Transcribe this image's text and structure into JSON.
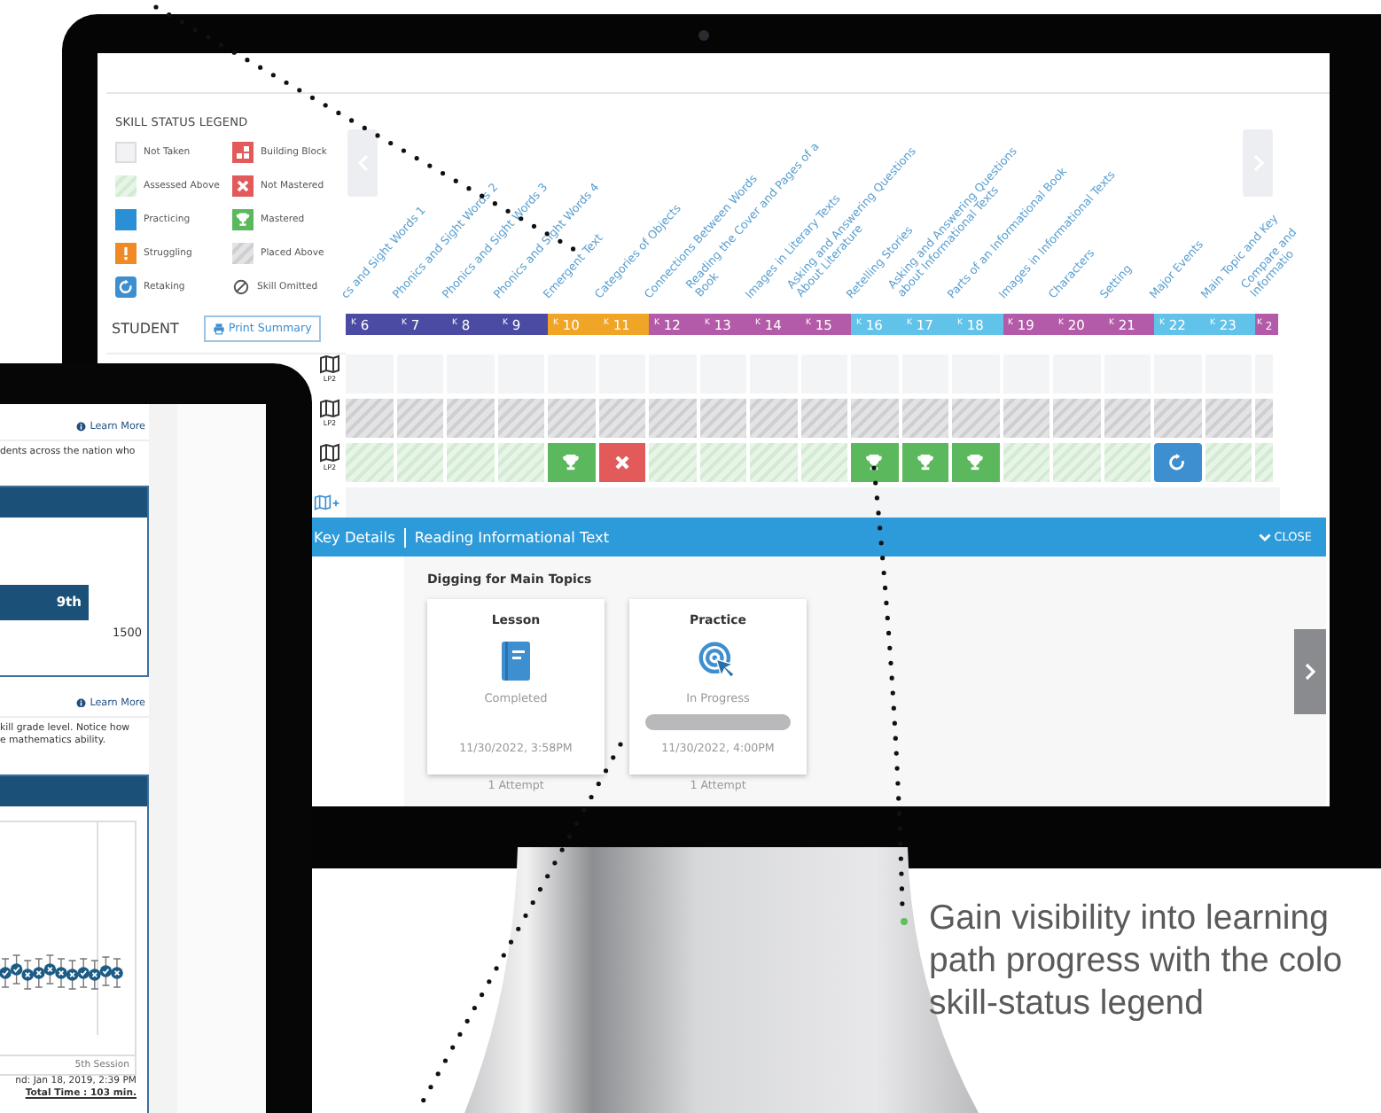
{
  "monitor": {
    "legend": {
      "title": "SKILL STATUS LEGEND",
      "items": [
        {
          "label": "Not Taken",
          "kind": "not-taken"
        },
        {
          "label": "Building Block",
          "kind": "building-block"
        },
        {
          "label": "Assessed Above",
          "kind": "assessed-above"
        },
        {
          "label": "Not Mastered",
          "kind": "not-mastered"
        },
        {
          "label": "Practicing",
          "kind": "practicing"
        },
        {
          "label": "Mastered",
          "kind": "mastered"
        },
        {
          "label": "Struggling",
          "kind": "struggling"
        },
        {
          "label": "Placed Above",
          "kind": "placed-above"
        },
        {
          "label": "Retaking",
          "kind": "retaking"
        },
        {
          "label": "Skill Omitted",
          "kind": "skill-omitted"
        }
      ]
    },
    "student_header": "STUDENT",
    "print_button": "Print Summary",
    "columns": [
      {
        "grade": "K",
        "number": "6",
        "skill": [
          "cs and Sight Words 1"
        ],
        "color": "#4b4ba3"
      },
      {
        "grade": "K",
        "number": "7",
        "skill": [
          "Phonics and Sight Words 2"
        ],
        "color": "#4b4ba3"
      },
      {
        "grade": "K",
        "number": "8",
        "skill": [
          "Phonics and Sight Words 3"
        ],
        "color": "#4b4ba3"
      },
      {
        "grade": "K",
        "number": "9",
        "skill": [
          "Phonics and Sight Words 4"
        ],
        "color": "#4b4ba3"
      },
      {
        "grade": "K",
        "number": "10",
        "skill": [
          "Emergent Text"
        ],
        "color": "#f0a526"
      },
      {
        "grade": "K",
        "number": "11",
        "skill": [
          "Categories of Objects"
        ],
        "color": "#f0a526"
      },
      {
        "grade": "K",
        "number": "12",
        "skill": [
          "Connections Between Words"
        ],
        "color": "#b35ba8"
      },
      {
        "grade": "K",
        "number": "13",
        "skill": [
          "Reading the Cover and Pages of a",
          "Book"
        ],
        "color": "#b35ba8"
      },
      {
        "grade": "K",
        "number": "14",
        "skill": [
          "Images in Literary Texts"
        ],
        "color": "#b35ba8"
      },
      {
        "grade": "K",
        "number": "15",
        "skill": [
          "Asking and Answering Questions",
          "About Literature"
        ],
        "color": "#b35ba8"
      },
      {
        "grade": "K",
        "number": "16",
        "skill": [
          "Retelling Stories"
        ],
        "color": "#62c3ea"
      },
      {
        "grade": "K",
        "number": "17",
        "skill": [
          "Asking and Answering Questions",
          "about Informational Texts"
        ],
        "color": "#62c3ea"
      },
      {
        "grade": "K",
        "number": "18",
        "skill": [
          "Parts of an Informational Book"
        ],
        "color": "#62c3ea"
      },
      {
        "grade": "K",
        "number": "19",
        "skill": [
          "Images in Informational Texts"
        ],
        "color": "#b35ba8"
      },
      {
        "grade": "K",
        "number": "20",
        "skill": [
          "Characters"
        ],
        "color": "#b35ba8"
      },
      {
        "grade": "K",
        "number": "21",
        "skill": [
          "Setting"
        ],
        "color": "#b35ba8"
      },
      {
        "grade": "K",
        "number": "22",
        "skill": [
          "Major Events"
        ],
        "color": "#62c3ea"
      },
      {
        "grade": "K",
        "number": "23",
        "skill": [
          "Main Topic and Key"
        ],
        "color": "#62c3ea"
      },
      {
        "grade": "K",
        "number": "2",
        "skill": [
          "Compare and",
          "Informatio"
        ],
        "color": "#b35ba8"
      }
    ],
    "rows": [
      {
        "path": "LP2",
        "cells": [
          {
            "kind": "not-taken"
          },
          {
            "kind": "not-taken"
          },
          {
            "kind": "not-taken"
          },
          {
            "kind": "not-taken"
          },
          {
            "kind": "not-taken"
          },
          {
            "kind": "not-taken"
          },
          {
            "kind": "not-taken"
          },
          {
            "kind": "not-taken"
          },
          {
            "kind": "not-taken"
          },
          {
            "kind": "not-taken"
          },
          {
            "kind": "not-taken"
          },
          {
            "kind": "not-taken"
          },
          {
            "kind": "not-taken"
          },
          {
            "kind": "not-taken"
          },
          {
            "kind": "not-taken"
          },
          {
            "kind": "not-taken"
          },
          {
            "kind": "not-taken"
          },
          {
            "kind": "not-taken"
          },
          {
            "kind": "not-taken"
          }
        ]
      },
      {
        "path": "LP2",
        "cells": [
          {
            "kind": "placed-above"
          },
          {
            "kind": "placed-above"
          },
          {
            "kind": "placed-above"
          },
          {
            "kind": "placed-above"
          },
          {
            "kind": "placed-above"
          },
          {
            "kind": "placed-above"
          },
          {
            "kind": "placed-above"
          },
          {
            "kind": "placed-above"
          },
          {
            "kind": "placed-above"
          },
          {
            "kind": "placed-above"
          },
          {
            "kind": "placed-above"
          },
          {
            "kind": "placed-above"
          },
          {
            "kind": "placed-above"
          },
          {
            "kind": "placed-above"
          },
          {
            "kind": "placed-above"
          },
          {
            "kind": "placed-above"
          },
          {
            "kind": "placed-above"
          },
          {
            "kind": "placed-above"
          },
          {
            "kind": "placed-above"
          }
        ]
      },
      {
        "path": "LP2",
        "cells": [
          {
            "kind": "assessed-above"
          },
          {
            "kind": "assessed-above"
          },
          {
            "kind": "assessed-above"
          },
          {
            "kind": "assessed-above"
          },
          {
            "kind": "mastered"
          },
          {
            "kind": "not-mastered"
          },
          {
            "kind": "assessed-above"
          },
          {
            "kind": "assessed-above"
          },
          {
            "kind": "assessed-above"
          },
          {
            "kind": "assessed-above"
          },
          {
            "kind": "mastered"
          },
          {
            "kind": "mastered"
          },
          {
            "kind": "mastered"
          },
          {
            "kind": "assessed-above"
          },
          {
            "kind": "assessed-above"
          },
          {
            "kind": "assessed-above"
          },
          {
            "kind": "retaking"
          },
          {
            "kind": "assessed-above"
          },
          {
            "kind": "assessed-above"
          }
        ]
      }
    ],
    "detail_panel": {
      "breadcrumb": [
        "Key Details",
        "Reading Informational Text"
      ],
      "close": "CLOSE",
      "topic": "Digging for Main Topics",
      "cards": [
        {
          "kind": "lesson",
          "title": "Lesson",
          "status": "Completed",
          "date": "11/30/2022, 3:58PM",
          "attempts": "1 Attempt"
        },
        {
          "kind": "practice",
          "title": "Practice",
          "status": "In Progress",
          "level": 0,
          "date": "11/30/2022, 4:00PM",
          "attempts": "1 Attempt"
        }
      ]
    }
  },
  "tablet": {
    "sections": [
      {
        "link": "Learn More",
        "text": [
          "dents across the nation who"
        ],
        "panel": {
          "kind": "grade-bar",
          "bar_label": "9th",
          "value": "1500"
        }
      },
      {
        "link": "Learn More",
        "text": [
          "kill grade level. Notice how",
          "e mathematics ability."
        ],
        "panel": {
          "kind": "session-chart",
          "axis_label": "5th Session",
          "footer": [
            "nd: Jan 18, 2019, 2:39 PM",
            "Total Time : 103 min."
          ]
        }
      }
    ]
  },
  "caption": {
    "lines": [
      "Gain visibility into learning",
      "path progress with the colo",
      "skill-status legend"
    ]
  }
}
